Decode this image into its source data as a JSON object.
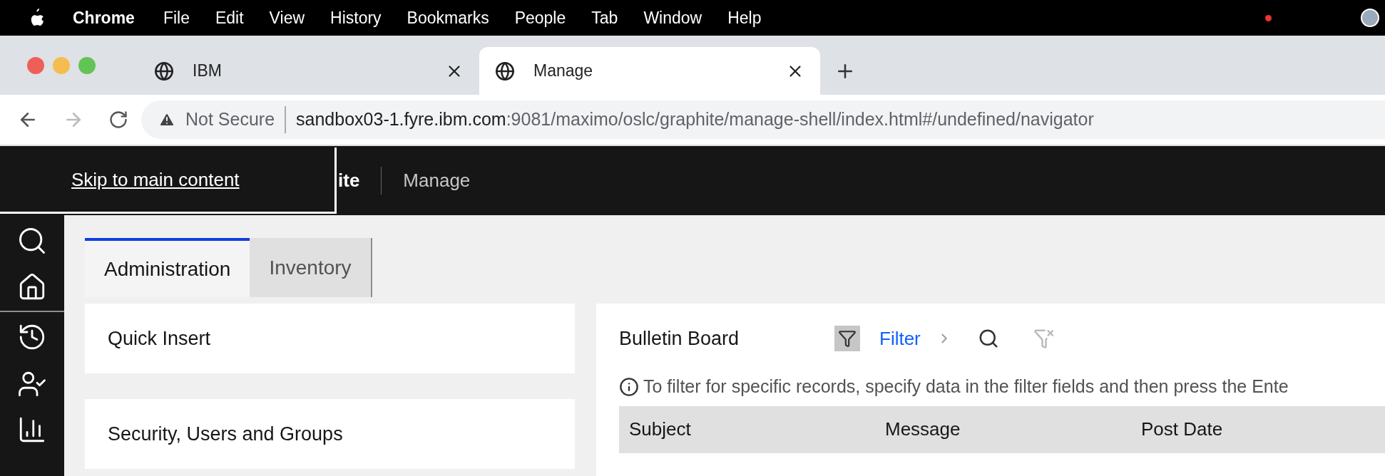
{
  "menu_bar": {
    "app_name": "Chrome",
    "items": [
      "File",
      "Edit",
      "View",
      "History",
      "Bookmarks",
      "People",
      "Tab",
      "Window",
      "Help"
    ]
  },
  "browser_tabs": [
    {
      "label": "IBM",
      "selected": false
    },
    {
      "label": "Manage",
      "selected": true
    }
  ],
  "address_bar": {
    "security": "Not Secure",
    "host": "sandbox03-1.fyre.ibm.com",
    "path": ":9081/maximo/oslc/graphite/manage-shell/index.html#/undefined/navigator"
  },
  "header": {
    "skip_link": "Skip to main content",
    "product": "ite",
    "app": "Manage"
  },
  "tabs": [
    {
      "label": "Administration",
      "selected": true
    },
    {
      "label": "Inventory",
      "selected": false
    }
  ],
  "cards": [
    "Quick Insert",
    "Security, Users and Groups"
  ],
  "bulletin": {
    "title": "Bulletin Board",
    "filter_active": true,
    "filter_label": "Filter",
    "info": "To filter for specific records, specify data in the filter fields and then press the Ente",
    "columns": [
      "Subject",
      "Message",
      "Post Date"
    ]
  }
}
